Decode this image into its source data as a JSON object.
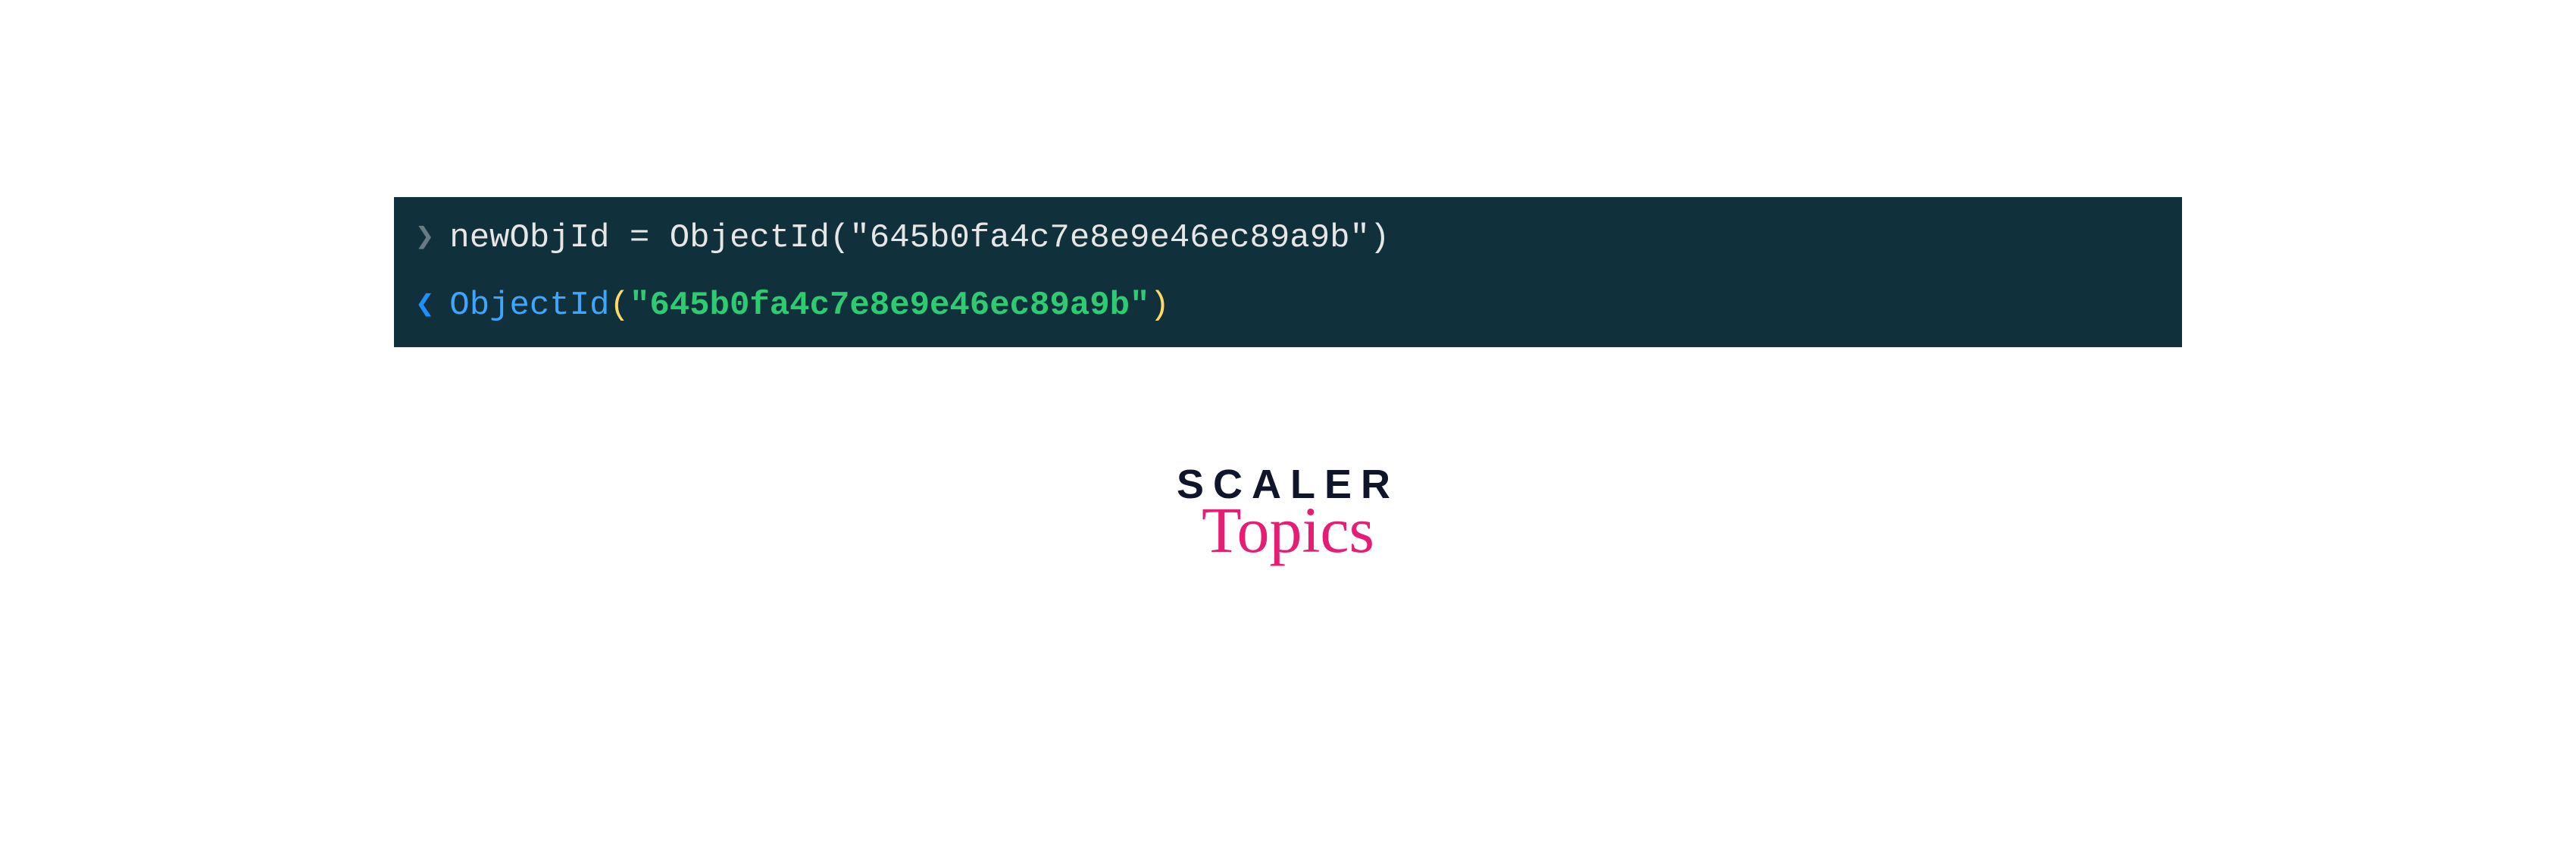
{
  "console": {
    "input": {
      "variable": "newObjId",
      "operator": " = ",
      "func": "ObjectId",
      "openParen": "(",
      "arg": "\"645b0fa4c7e8e9e46ec89a9b\"",
      "closeParen": ")"
    },
    "output": {
      "func": "ObjectId",
      "openParen": "(",
      "arg": "\"645b0fa4c7e8e9e46ec89a9b\"",
      "closeParen": ")"
    }
  },
  "logo": {
    "primary": "SCALER",
    "secondary": "Topics"
  }
}
